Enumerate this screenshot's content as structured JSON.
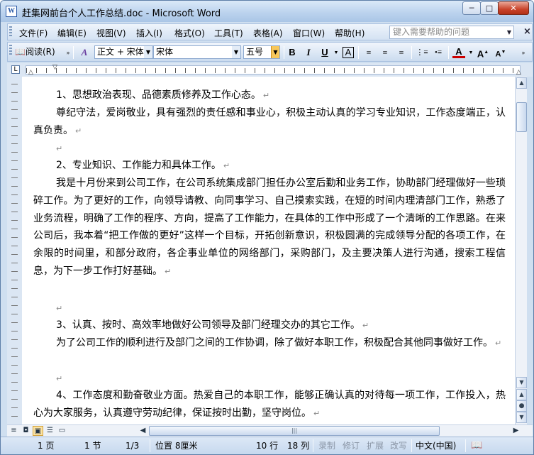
{
  "window": {
    "title": "赶集网前台个人工作总结.doc - Microsoft Word",
    "app_icon": "word-doc-icon",
    "buttons": {
      "minimize": "─",
      "maximize": "□",
      "close": "✕"
    }
  },
  "menubar": {
    "items": [
      "文件(F)",
      "编辑(E)",
      "视图(V)",
      "插入(I)",
      "格式(O)",
      "工具(T)",
      "表格(A)",
      "窗口(W)",
      "帮助(H)"
    ],
    "help_placeholder": "键入需要帮助的问题"
  },
  "toolbar": {
    "reading_label": "阅读(R)",
    "style_value": "正文 + 宋体",
    "font_value": "宋体",
    "size_value": "五号",
    "bold": "B",
    "italic": "I",
    "underline": "U",
    "char_border": "A",
    "font_color": "A",
    "grow_font": "A",
    "shrink_font": "A"
  },
  "document": {
    "paragraphs": [
      {
        "kind": "heading",
        "text": "1、思想政治表现、品德素质修养及工作心态。"
      },
      {
        "kind": "body",
        "text": "尊纪守法，爱岗敬业，具有强烈的责任感和事业心，积极主动认真的学习专业知识，工作态度端正，认真负责。"
      },
      {
        "kind": "heading",
        "text": "2、专业知识、工作能力和具体工作。"
      },
      {
        "kind": "body",
        "text": "我是十月份来到公司工作，在公司系统集成部门担任办公室后勤和业务工作，协助部门经理做好一些琐碎工作。为了更好的工作，向领导请教、向同事学习、自己摸索实践，在短的时间内理清部门工作，熟悉了业务流程，明确了工作的程序、方向，提高了工作能力，在具体的工作中形成了一个清晰的工作思路。在来公司后，我本着“把工作做的更好”这样一个目标，开拓创新意识，积极圆满的完成领导分配的各项工作，在余限的时间里，和部分政府，各企事业单位的网络部门，采购部门，及主要决策人进行沟通，搜索工程信息，为下一步工作打好基础。"
      },
      {
        "kind": "heading",
        "text": "3、认真、按时、高效率地做好公司领导及部门经理交办的其它工作。"
      },
      {
        "kind": "body",
        "text": "为了公司工作的顺利进行及部门之间的工作协调，除了做好本职工作，积极配合其他同事做好工作。"
      },
      {
        "kind": "body",
        "text": "4、工作态度和勤奋敬业方面。热爱自己的本职工作，能够正确认真的对待每一项工作，工作投入，热心为大家服务，认真遵守劳动纪律，保证按时出勤，坚守岗位。"
      }
    ],
    "paragraph_mark": "↵"
  },
  "statusbar": {
    "page": "1 页",
    "section": "1 节",
    "page_of": "1/3",
    "position": "位置 8厘米",
    "line": "10 行",
    "column": "18 列",
    "rec": "录制",
    "trk": "修订",
    "ext": "扩展",
    "ovr": "改写",
    "language": "中文(中国)"
  }
}
